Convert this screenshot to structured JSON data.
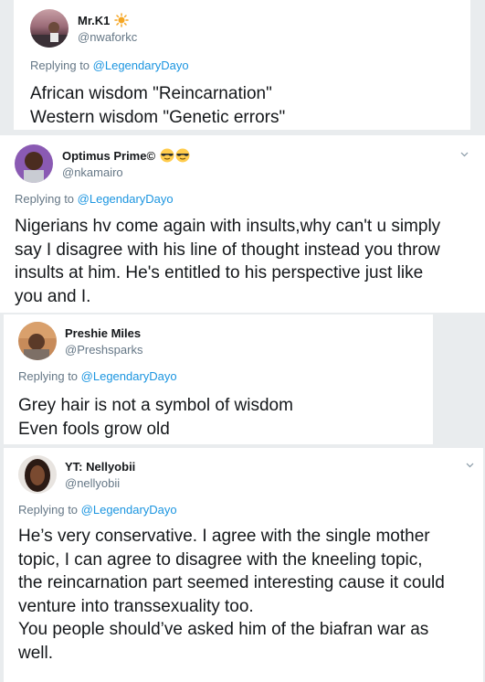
{
  "tweets": [
    {
      "name": "Mr.K1",
      "handle": "@nwaforkc",
      "replying_prefix": "Replying to ",
      "replying_to": "@LegendaryDayo",
      "lines": [
        "African wisdom \"Reincarnation\"",
        "Western wisdom \"Genetic errors\""
      ],
      "badge_icon": "sun-emoji",
      "avatar_icon": "profile-photo"
    },
    {
      "name": "Optimus Prime©",
      "handle": "@nkamairo",
      "replying_prefix": "Replying to ",
      "replying_to": "@LegendaryDayo",
      "lines": [
        "Nigerians hv come again with insults,why can't u simply",
        "say I disagree with his line of thought instead you throw",
        "insults at him. He's entitled to his perspective just like",
        "you and I."
      ],
      "badge_icon": "sunglasses-emoji",
      "avatar_icon": "profile-photo"
    },
    {
      "name": "Preshie Miles",
      "handle": "@Preshsparks",
      "replying_prefix": "Replying to ",
      "replying_to": "@LegendaryDayo",
      "lines": [
        "Grey hair is not a symbol of wisdom",
        "Even fools grow old"
      ],
      "avatar_icon": "profile-photo"
    },
    {
      "name": "YT: Nellyobii",
      "handle": "@nellyobii",
      "replying_prefix": "Replying to ",
      "replying_to": "@LegendaryDayo",
      "lines": [
        "He’s very conservative. I agree with the single mother",
        "topic, I can agree to disagree with the kneeling topic,",
        "the reincarnation part seemed interesting cause it could",
        "venture into transsexuality too.",
        "You people should’ve asked him of the biafran war as",
        "well."
      ],
      "avatar_icon": "profile-photo"
    }
  ],
  "colors": {
    "text": "#14171a",
    "secondary": "#657786",
    "link": "#1b95e0",
    "border": "#e6ecf0"
  }
}
